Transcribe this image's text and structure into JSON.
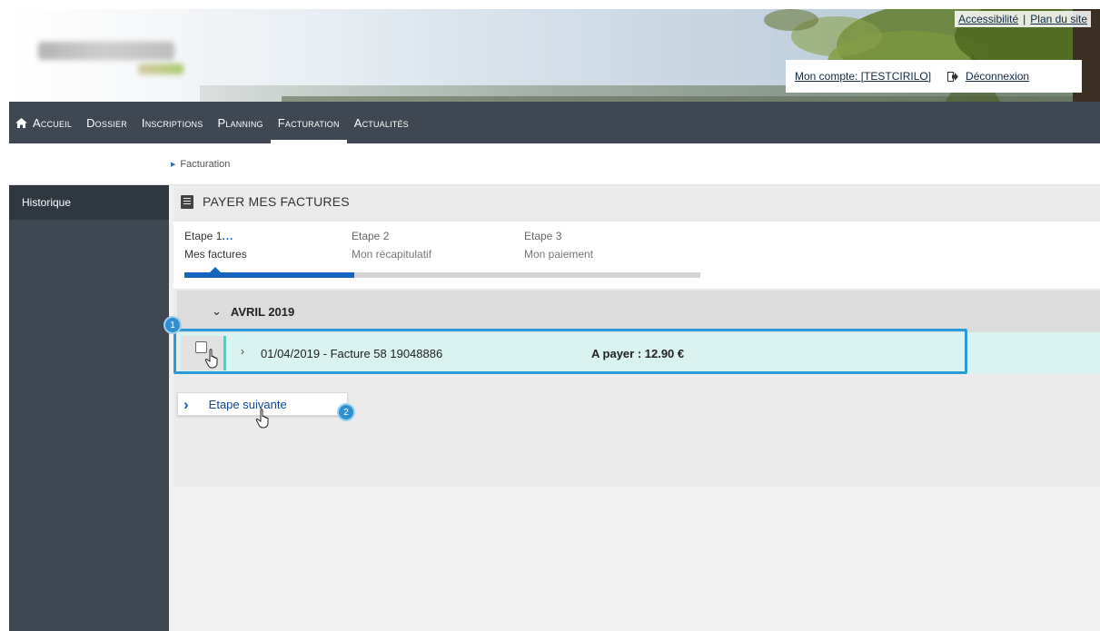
{
  "header": {
    "links": [
      "Accessibilité",
      "Plan du site"
    ],
    "account_label": "Mon compte: [TESTCIRILO]",
    "logout_label": "Déconnexion"
  },
  "nav": {
    "items": [
      "Accueil",
      "Dossier",
      "Inscriptions",
      "Planning",
      "Facturation",
      "Actualités"
    ],
    "active": "Facturation"
  },
  "breadcrumb": {
    "current": "Facturation"
  },
  "sidebar": {
    "items": [
      "Historique"
    ]
  },
  "main": {
    "title": "PAYER MES FACTURES",
    "steps": [
      {
        "number": "Etape 1",
        "indicator": "...",
        "label": "Mes factures"
      },
      {
        "number": "Etape 2",
        "label": "Mon récapitulatif"
      },
      {
        "number": "Etape 3",
        "label": "Mon paiement"
      }
    ],
    "progress_fraction": 0.33,
    "month": "AVRIL 2019",
    "invoice": {
      "description": "01/04/2019 - Facture 58 19048886",
      "amount": "A payer : 12.90 €"
    },
    "next_button": "Etape suivante",
    "annotations": [
      "1",
      "2"
    ]
  },
  "colors": {
    "nav_bg": "#3e4752",
    "accent": "#1565c0",
    "row_bg": "#d8f3f0",
    "highlight": "#2c9ad6"
  },
  "icons": [
    "home-icon",
    "logout-icon",
    "invoice-icon",
    "chevron-down-icon",
    "chevron-right-icon",
    "pointer-hand-icon"
  ]
}
